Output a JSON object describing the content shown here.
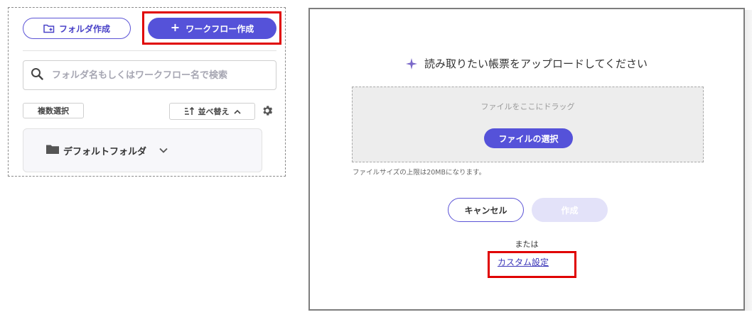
{
  "left_panel": {
    "folder_create_label": "フォルダ作成",
    "workflow_create_label": "ワークフロー作成",
    "search_placeholder": "フォルダ名もしくはワークフロー名で検索",
    "multi_select_label": "複数選択",
    "sort_label": "並べ替え",
    "folders": [
      {
        "name": "デフォルトフォルダ"
      }
    ]
  },
  "modal": {
    "title": "読み取りたい帳票をアップロードしてください",
    "dropzone_text": "ファイルをここにドラッグ",
    "file_select_label": "ファイルの選択",
    "size_note": "ファイルサイズの上限は20MBになります。",
    "cancel_label": "キャンセル",
    "create_label": "作成",
    "or_text": "または",
    "custom_settings_label": "カスタム設定"
  },
  "colors": {
    "accent": "#5552d9",
    "highlight": "#e00000",
    "disabled_button": "#e3e2f9"
  }
}
